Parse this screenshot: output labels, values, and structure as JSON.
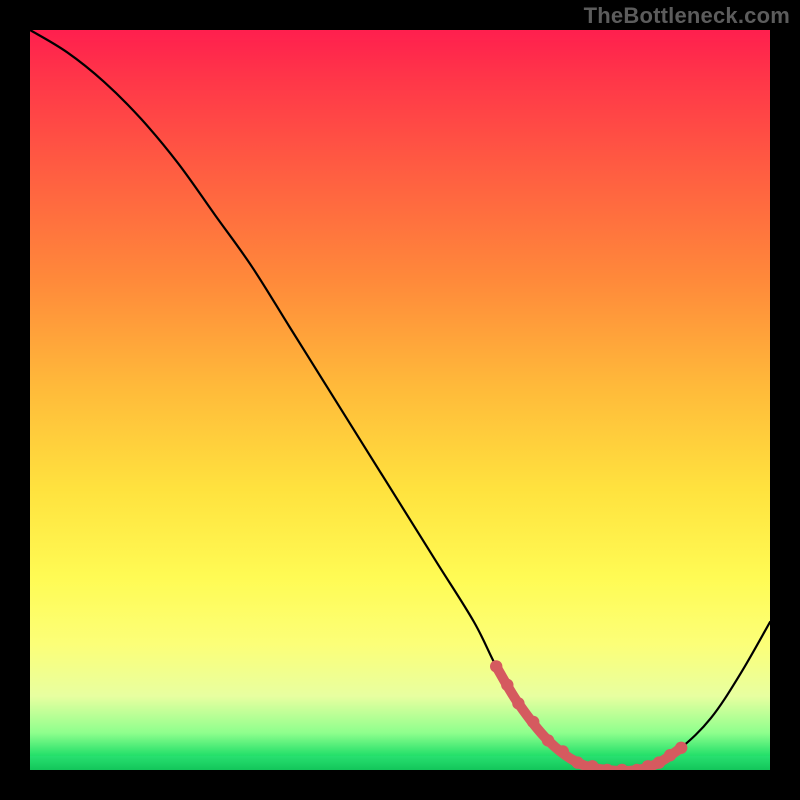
{
  "attribution": "TheBottleneck.com",
  "colors": {
    "curve_stroke": "#000000",
    "highlight_stroke": "#d55a5f",
    "highlight_fill": "#d55a5f"
  },
  "chart_data": {
    "type": "line",
    "title": "",
    "xlabel": "",
    "ylabel": "",
    "xlim": [
      0,
      100
    ],
    "ylim": [
      0,
      100
    ],
    "series": [
      {
        "name": "bottleneck-curve",
        "x": [
          0,
          5,
          10,
          15,
          20,
          25,
          30,
          35,
          40,
          45,
          50,
          55,
          60,
          63,
          66,
          70,
          74,
          78,
          82,
          85,
          88,
          92,
          96,
          100
        ],
        "y": [
          100,
          97,
          93,
          88,
          82,
          75,
          68,
          60,
          52,
          44,
          36,
          28,
          20,
          14,
          9,
          4,
          1,
          0,
          0,
          1,
          3,
          7,
          13,
          20
        ]
      }
    ],
    "highlight_range": {
      "series": "bottleneck-curve",
      "x_start": 63,
      "x_end": 88,
      "note": "flat valley segment drawn with thick pink stroke + dots"
    }
  }
}
